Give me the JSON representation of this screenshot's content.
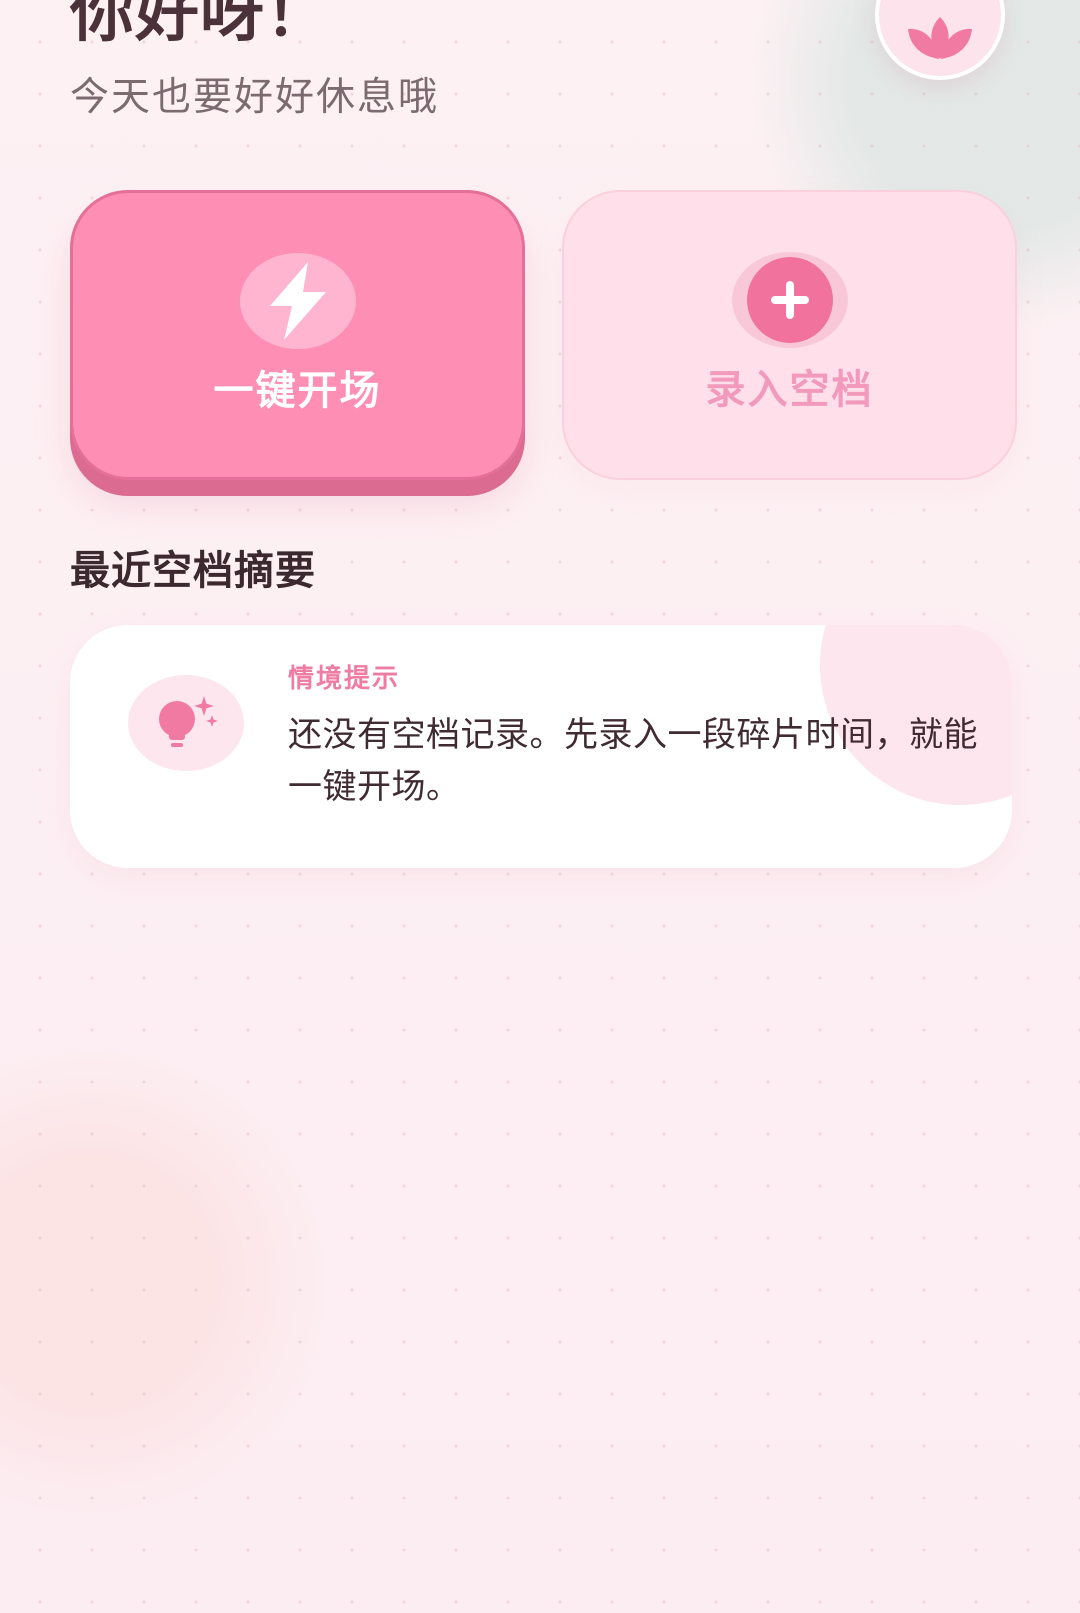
{
  "header": {
    "greeting": "你好呀！",
    "subtitle": "今天也要好好休息哦",
    "profile_icon": "lotus-icon"
  },
  "actions": {
    "quick_start": {
      "label": "一键开场",
      "icon": "lightning-icon",
      "background": "#ff8eb5"
    },
    "record_gap": {
      "label": "录入空档",
      "icon": "plus-icon",
      "background": "#ffe0ea"
    }
  },
  "recent_summary": {
    "title": "最近空档摘要",
    "tip": {
      "label": "情境提示",
      "message": "还没有空档记录。先录入一段碎片时间，就能一键开场。",
      "icon": "lightbulb-icon"
    }
  },
  "colors": {
    "accent": "#ff8eb5",
    "accent_dark": "#f1739d",
    "background": "#fdf1f4",
    "text_primary": "#3c2930",
    "text_secondary": "#7b6a70"
  }
}
